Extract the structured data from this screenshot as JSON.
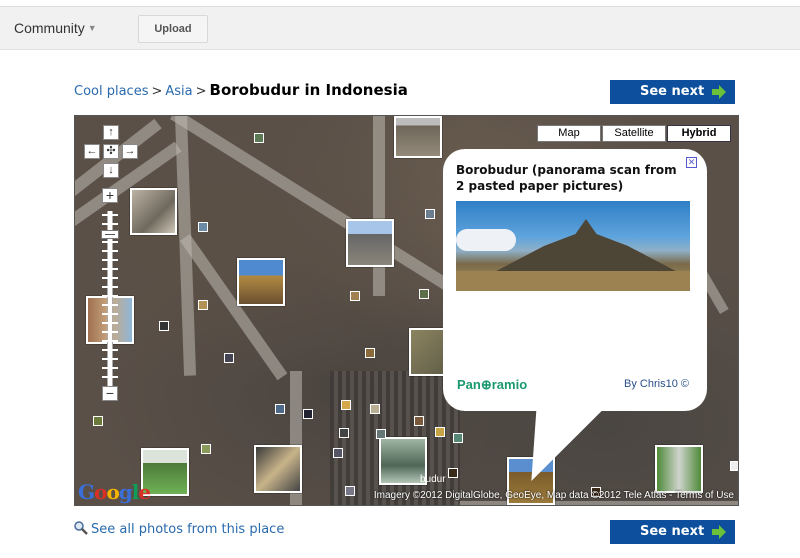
{
  "topbar": {
    "community_label": "Community",
    "upload_label": "Upload"
  },
  "breadcrumb": {
    "items": [
      "Cool places",
      "Asia"
    ],
    "separator": ">",
    "current": "Borobudur in Indonesia"
  },
  "buttons": {
    "see_next": "See next",
    "see_all": "See all photos from this place"
  },
  "map": {
    "types": [
      {
        "label": "Map",
        "active": false
      },
      {
        "label": "Satellite",
        "active": false
      },
      {
        "label": "Hybrid",
        "active": true
      }
    ],
    "nav": {
      "up": "↑",
      "down": "↓",
      "left": "←",
      "right": "→",
      "center": "✣",
      "zoom_in": "+",
      "zoom_out": "−"
    },
    "place_label": "budur",
    "attribution": "Imagery ©2012 DigitalGlobe, GeoEye, Map data ©2012 Tele Atlas - ",
    "terms_link": "Terms of Use",
    "google_logo": [
      "G",
      "o",
      "o",
      "g",
      "l",
      "e"
    ],
    "google_colors": [
      "#3b6fd8",
      "#d93025",
      "#f4b400",
      "#3b6fd8",
      "#0f9d58",
      "#d93025"
    ]
  },
  "info_window": {
    "title": "Borobudur (panorama scan from 2 pasted paper pictures)",
    "close_icon": "☒",
    "logo": "Pan⊕ramio",
    "credit": "By Chris10 ©"
  },
  "colors": {
    "link": "#2a6aad",
    "button_bg": "#0d4f9c",
    "arrow_green": "#6cc13a",
    "panoramio_green": "#1a9a6c"
  }
}
